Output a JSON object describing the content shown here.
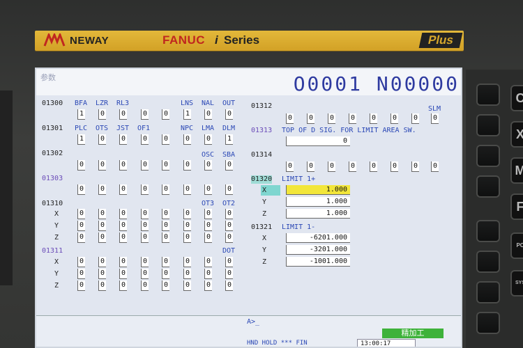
{
  "brand": {
    "line1": "NEWAY",
    "line2": "FANUC",
    "line3": "i",
    "line4": "Series",
    "plus": "Plus"
  },
  "screen": {
    "title": "参数",
    "program": "O0001 N00000",
    "params": [
      {
        "id": "01300",
        "bits": [
          "BFA",
          "LZR",
          "RL3",
          "",
          "",
          "LNS",
          "NAL",
          "OUT"
        ],
        "values": [
          "1",
          "0",
          "0",
          "0",
          "0",
          "1",
          "0",
          "0"
        ]
      },
      {
        "id": "01301",
        "bits": [
          "PLC",
          "OTS",
          "JST",
          "OF1",
          "",
          "NPC",
          "LMA",
          "DLM"
        ],
        "values": [
          "1",
          "0",
          "0",
          "0",
          "0",
          "0",
          "0",
          "1"
        ]
      },
      {
        "id": "01302",
        "bits": [
          "",
          "",
          "",
          "",
          "",
          "",
          "OSC",
          "SBA"
        ],
        "values": [
          "0",
          "0",
          "0",
          "0",
          "0",
          "0",
          "0",
          "0"
        ]
      },
      {
        "id": "01303",
        "bits": [
          "",
          "",
          "",
          "",
          "",
          "",
          "",
          ""
        ],
        "values": [
          "0",
          "0",
          "0",
          "0",
          "0",
          "0",
          "0",
          "0"
        ]
      }
    ],
    "p1310": {
      "id": "01310",
      "bits": [
        "OT3",
        "OT2"
      ],
      "axes": [
        "X",
        "Y",
        "Z"
      ],
      "rows": [
        [
          "0",
          "0",
          "0",
          "0",
          "0",
          "0",
          "0",
          "0"
        ],
        [
          "0",
          "0",
          "0",
          "0",
          "0",
          "0",
          "0",
          "0"
        ],
        [
          "0",
          "0",
          "0",
          "0",
          "0",
          "0",
          "0",
          "0"
        ]
      ]
    },
    "p1311": {
      "id": "01311",
      "bits": [
        "DOT"
      ],
      "axes": [
        "X",
        "Y",
        "Z"
      ],
      "rows": [
        [
          "0",
          "0",
          "0",
          "0",
          "0",
          "0",
          "0",
          "0"
        ],
        [
          "0",
          "0",
          "0",
          "0",
          "0",
          "0",
          "0",
          "0"
        ],
        [
          "0",
          "0",
          "0",
          "0",
          "0",
          "0",
          "0",
          "0"
        ]
      ]
    },
    "p1312": {
      "id": "01312",
      "bit": "SLM",
      "values": [
        "0",
        "0",
        "0",
        "0",
        "0",
        "0",
        "0",
        "0"
      ]
    },
    "p1313": {
      "id": "01313",
      "label": "TOP OF D SIG. FOR LIMIT AREA SW.",
      "value": "0"
    },
    "p1314": {
      "id": "01314",
      "values": [
        "0",
        "0",
        "0",
        "0",
        "0",
        "0",
        "0",
        "0"
      ]
    },
    "p1320": {
      "id": "01320",
      "label": "LIMIT 1+",
      "axes": [
        "X",
        "Y",
        "Z"
      ],
      "values": [
        "1.000",
        "1.000",
        "1.000"
      ]
    },
    "p1321": {
      "id": "01321",
      "label": "LIMIT 1-",
      "axes": [
        "X",
        "Y",
        "Z"
      ],
      "values": [
        "-6201.000",
        "-3201.000",
        "-1001.000"
      ]
    },
    "prompt": "A>_",
    "mode": "精加工",
    "status": "HND  HOLD *** FIN",
    "clock": "13:00:17"
  },
  "keys": {
    "k1": "C",
    "k2": "X",
    "k3": "M",
    "k4": "F",
    "k5": "PC",
    "k6": "SYS"
  },
  "colors": {
    "selected": "#f2e63a",
    "mode_bg": "#3eb23a",
    "program": "#2e3aa0"
  }
}
